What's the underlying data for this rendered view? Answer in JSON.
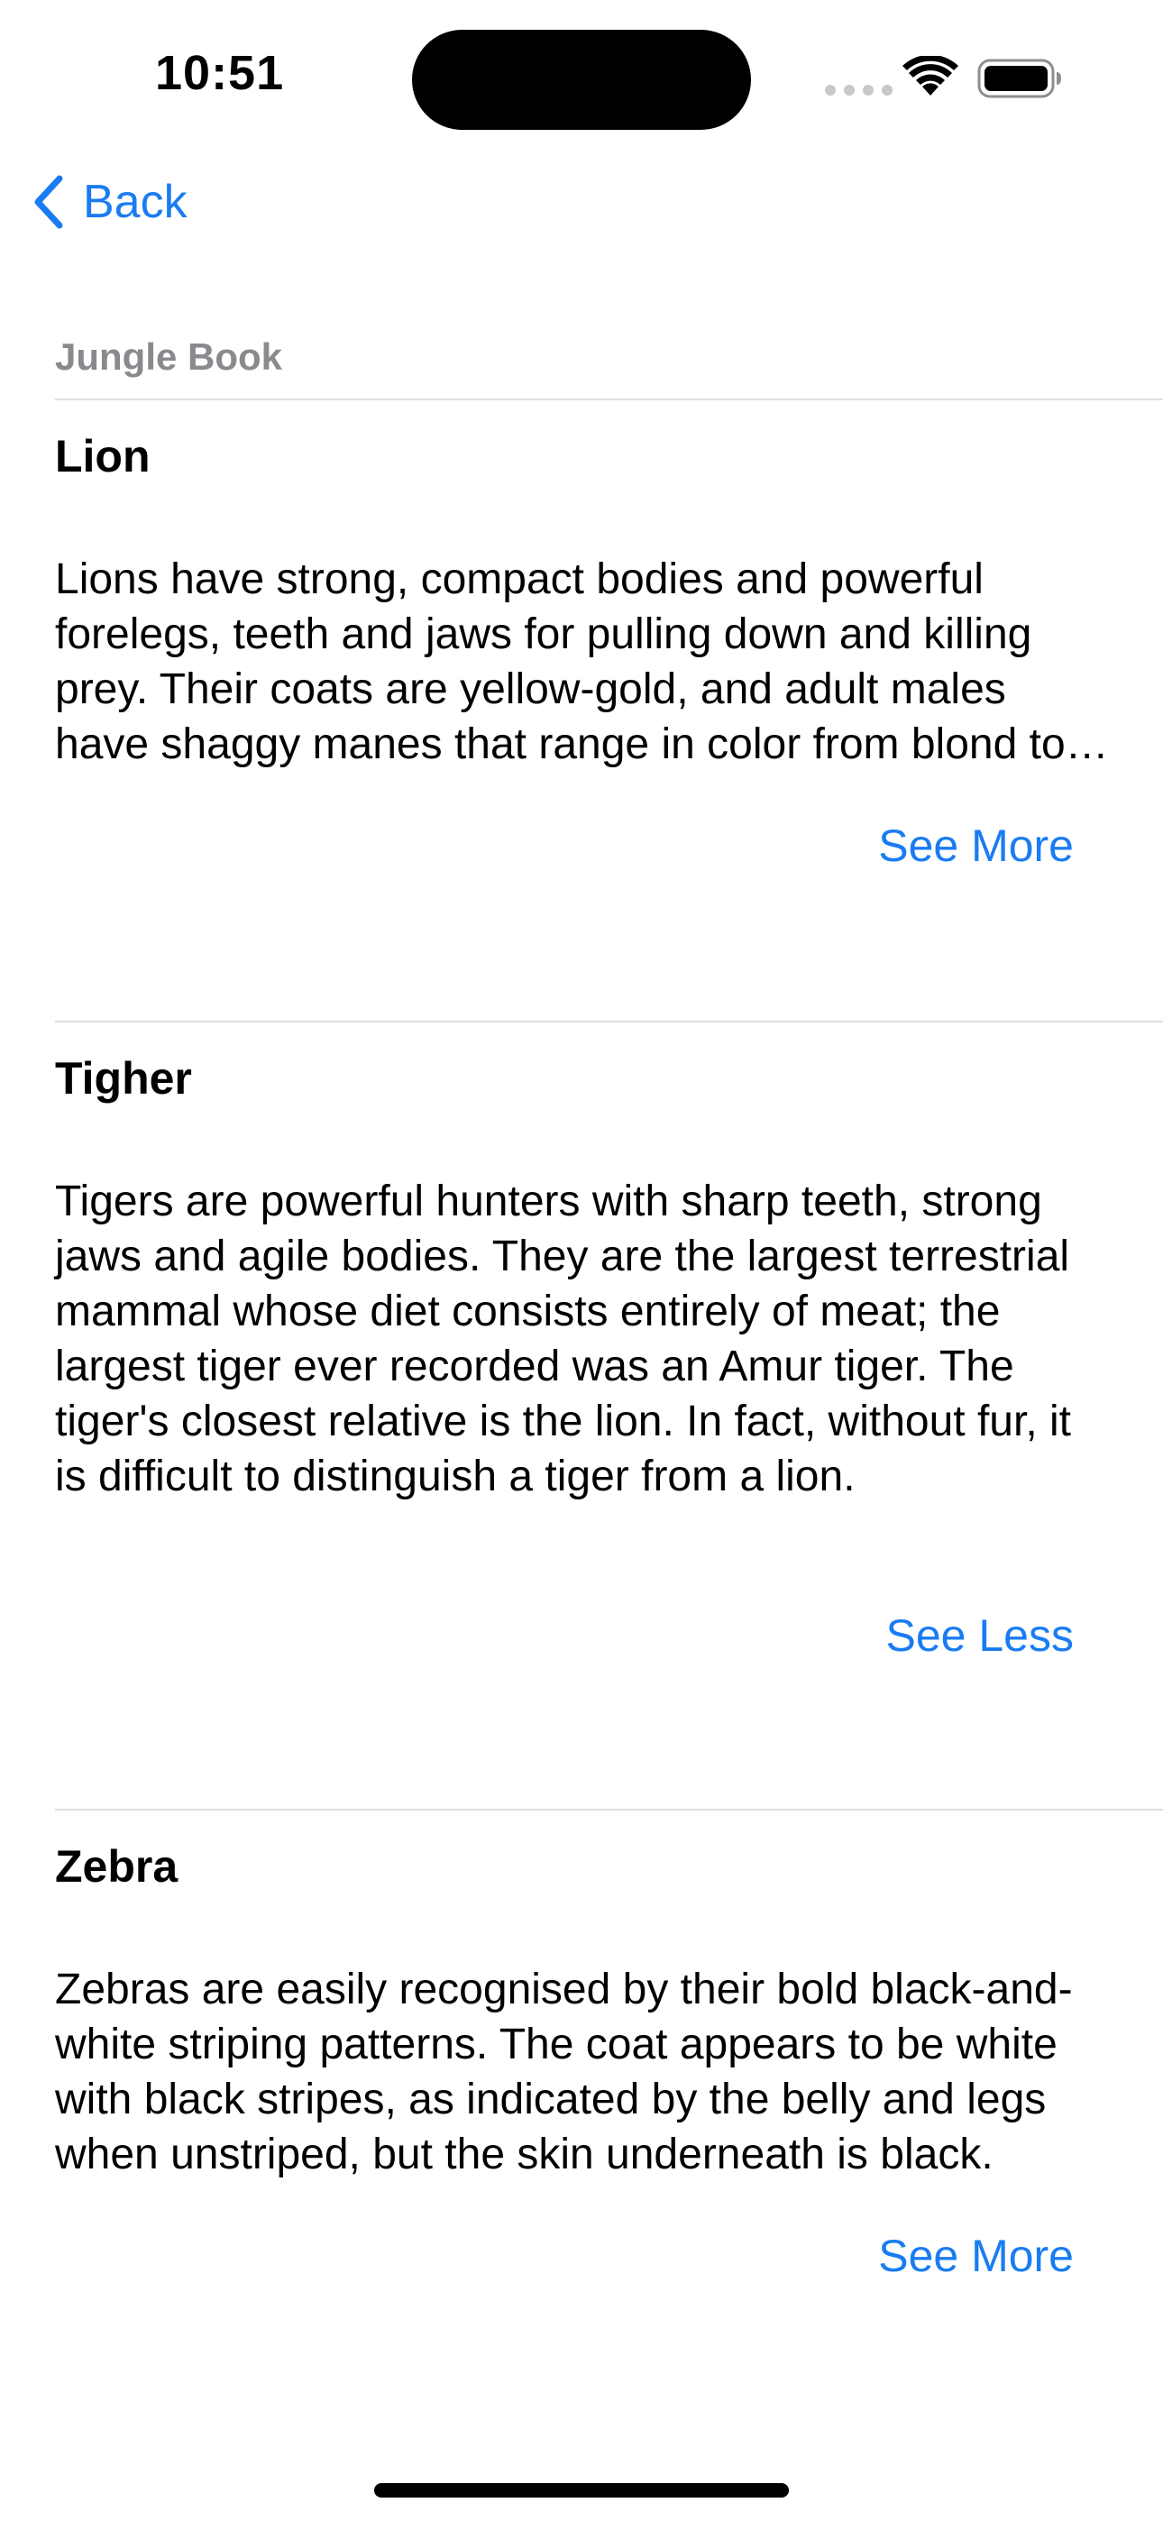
{
  "status_bar": {
    "time": "10:51",
    "icons": [
      "signal-dots-icon",
      "wifi-icon",
      "battery-icon"
    ]
  },
  "nav": {
    "back_label": "Back",
    "back_icon": "chevron-left-icon",
    "accent_color": "#1a7cf2"
  },
  "section": {
    "header": "Jungle Book"
  },
  "animals": [
    {
      "title": "Lion",
      "text": "Lions have strong, compact bodies and powerful forelegs, teeth and jaws for pulling down and killing prey. Their coats are yellow-gold, and adult males have shaggy manes that range in color from blond to reddish-brown to black.",
      "expanded": false,
      "toggle_label": "See More"
    },
    {
      "title": "Tigher",
      "text": "Tigers are powerful hunters with sharp teeth, strong jaws and agile bodies. They are the largest terrestrial mammal whose diet consists entirely of meat; the largest tiger ever recorded was an Amur tiger. The tiger's closest relative is the lion. In fact, without fur, it is difficult to distinguish a tiger from a lion.",
      "expanded": true,
      "toggle_label": "See Less"
    },
    {
      "title": "Zebra",
      "text": "Zebras are easily recognised by their bold black-and-white striping patterns. The coat appears to be white with black stripes, as indicated by the belly and legs when unstriped, but the skin underneath is black.",
      "expanded": false,
      "toggle_label": "See More"
    }
  ]
}
